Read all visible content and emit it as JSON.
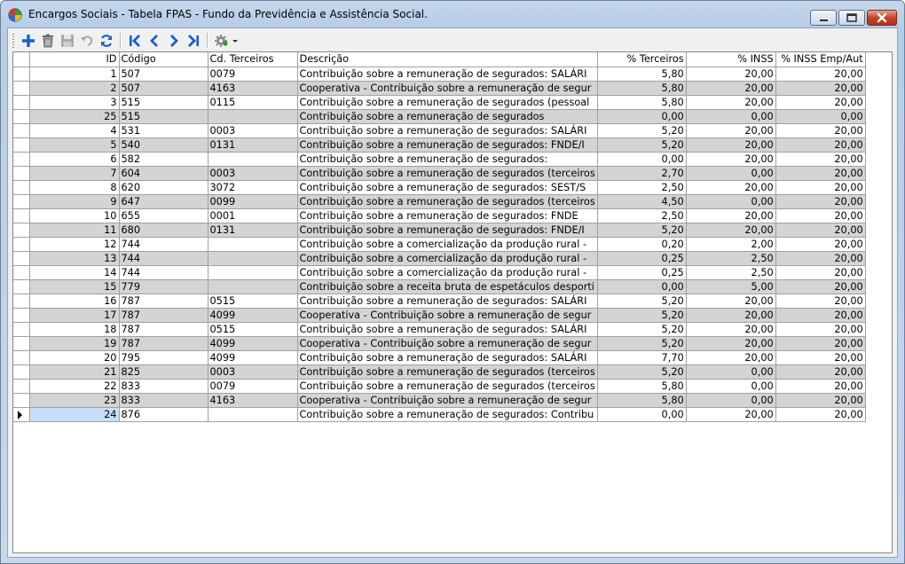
{
  "window": {
    "title": "Encargos Sociais - Tabela FPAS - Fundo da Previdência e Assistência Social."
  },
  "toolbar": {
    "buttons": [
      "add-icon",
      "delete-icon",
      "save-icon",
      "undo-icon",
      "refresh-icon",
      "first-record-icon",
      "previous-record-icon",
      "next-record-icon",
      "last-record-icon",
      "tools-dropdown-icon"
    ]
  },
  "colors": {
    "alt_row": "#d4d4d4",
    "selected_cell": "#c6defa",
    "nav_blue": "#1c5fc8"
  },
  "grid": {
    "columns": [
      "ID",
      "Código",
      "Cd. Terceiros",
      "Descrição",
      "% Terceiros",
      "% INSS",
      "% INSS Emp/Aut"
    ],
    "rows": [
      [
        "1",
        "507",
        "0079",
        "Contribuição sobre a remuneração de segurados: SALÁRI",
        "5,80",
        "20,00",
        "20,00"
      ],
      [
        "2",
        "507",
        "4163",
        "Cooperativa - Contribuição sobre a remuneração de segur",
        "5,80",
        "20,00",
        "20,00"
      ],
      [
        "3",
        "515",
        "0115",
        "Contribuição sobre a remuneração de segurados (pessoal",
        "5,80",
        "20,00",
        "20,00"
      ],
      [
        "25",
        "515",
        "",
        "Contribuição sobre a remuneração de segurados",
        "0,00",
        "0,00",
        "0,00"
      ],
      [
        "4",
        "531",
        "0003",
        "Contribuição sobre a remuneração de segurados: SALÁRI",
        "5,20",
        "20,00",
        "20,00"
      ],
      [
        "5",
        "540",
        "0131",
        "Contribuição sobre a remuneração de segurados: FNDE/I",
        "5,20",
        "20,00",
        "20,00"
      ],
      [
        "6",
        "582",
        "",
        "Contribuição sobre a remuneração de segurados:",
        "0,00",
        "20,00",
        "20,00"
      ],
      [
        "7",
        "604",
        "0003",
        "Contribuição sobre a remuneração de segurados (terceiros",
        "2,70",
        "0,00",
        "20,00"
      ],
      [
        "8",
        "620",
        "3072",
        "Contribuição sobre a remuneração de segurados: SEST/S",
        "2,50",
        "20,00",
        "20,00"
      ],
      [
        "9",
        "647",
        "0099",
        "Contribuição sobre a remuneração de segurados (terceiros",
        "4,50",
        "0,00",
        "20,00"
      ],
      [
        "10",
        "655",
        "0001",
        "Contribuição sobre a remuneração de segurados: FNDE",
        "2,50",
        "20,00",
        "20,00"
      ],
      [
        "11",
        "680",
        "0131",
        "Contribuição sobre a remuneração de segurados: FNDE/I",
        "5,20",
        "20,00",
        "20,00"
      ],
      [
        "12",
        "744",
        "",
        "Contribuição sobre a comercialização da produção rural -",
        "0,20",
        "2,00",
        "20,00"
      ],
      [
        "13",
        "744",
        "",
        "Contribuição sobre a comercialização da produção rural -",
        "0,25",
        "2,50",
        "20,00"
      ],
      [
        "14",
        "744",
        "",
        "Contribuição sobre a comercialização da produção rural -",
        "0,25",
        "2,50",
        "20,00"
      ],
      [
        "15",
        "779",
        "",
        "Contribuição sobre a receita bruta de espetáculos desporti",
        "0,00",
        "5,00",
        "20,00"
      ],
      [
        "16",
        "787",
        "0515",
        "Contribuição sobre a remuneração de segurados: SALÁRI",
        "5,20",
        "20,00",
        "20,00"
      ],
      [
        "17",
        "787",
        "4099",
        "Cooperativa - Contribuição sobre a remuneração de segur",
        "5,20",
        "20,00",
        "20,00"
      ],
      [
        "18",
        "787",
        "0515",
        "Contribuição sobre a remuneração de segurados: SALÁRI",
        "5,20",
        "20,00",
        "20,00"
      ],
      [
        "19",
        "787",
        "4099",
        "Cooperativa - Contribuição sobre a remuneração de segur",
        "5,20",
        "20,00",
        "20,00"
      ],
      [
        "20",
        "795",
        "4099",
        "Contribuição sobre a remuneração de segurados: SALÁRI",
        "7,70",
        "20,00",
        "20,00"
      ],
      [
        "21",
        "825",
        "0003",
        "Contribuição sobre a remuneração de segurados (terceiros",
        "5,20",
        "0,00",
        "20,00"
      ],
      [
        "22",
        "833",
        "0079",
        "Contribuição sobre a remuneração de segurados (terceiros",
        "5,80",
        "0,00",
        "20,00"
      ],
      [
        "23",
        "833",
        "4163",
        "Cooperativa - Contribuição sobre a remuneração de segur",
        "5,80",
        "0,00",
        "20,00"
      ],
      [
        "24",
        "876",
        "",
        "Contribuição sobre a remuneração de segurados: Contribu",
        "0,00",
        "20,00",
        "20,00"
      ]
    ],
    "selected_row": 24
  }
}
